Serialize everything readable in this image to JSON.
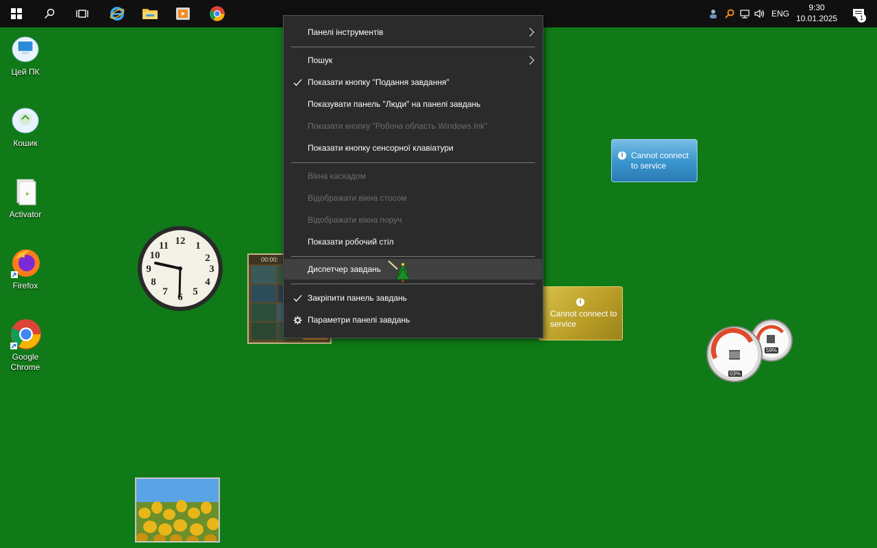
{
  "taskbar": {
    "buttons": [
      "start",
      "search",
      "task-view",
      "internet-explorer",
      "file-explorer",
      "media-player",
      "google-chrome"
    ],
    "lang": "ENG",
    "time": "9:30",
    "date": "10.01.2025",
    "notifications": "1"
  },
  "desktop": {
    "icons": [
      {
        "label": "Цей ПК"
      },
      {
        "label": "Кошик"
      },
      {
        "label": "Activator"
      },
      {
        "label": "Firefox"
      },
      {
        "label": "Google Chrome"
      }
    ]
  },
  "menu": {
    "items": [
      {
        "label": "Панелі інструментів",
        "submenu": true
      },
      {
        "label": "Пошук",
        "submenu": true
      },
      {
        "label": "Показати кнопку \"Подання завдання\"",
        "checked": true
      },
      {
        "label": "Показувати панель \"Люди\" на панелі завдань"
      },
      {
        "label": "Показати кнопку \"Робоча область Windows Ink\"",
        "disabled": true
      },
      {
        "label": "Показати кнопку сенсорної клавіатури"
      },
      {
        "label": "Вікна каскадом",
        "disabled": true
      },
      {
        "label": "Відображати вікна стосом",
        "disabled": true
      },
      {
        "label": "Відображати вікна поруч",
        "disabled": true
      },
      {
        "label": "Показати робочий стіл"
      },
      {
        "label": "Диспетчер завдань",
        "hovered": true
      },
      {
        "label": "Закріпити панель завдань",
        "checked": true
      },
      {
        "label": "Параметри панелі завдань",
        "icon": "gear-icon"
      }
    ]
  },
  "gadgets": {
    "weather_message": "Cannot connect to service",
    "currency_message": "Cannot connect to service",
    "cpu_percent": "03%",
    "memory_percent": "59%",
    "puzzle_timer": "00:00:"
  },
  "colors": {
    "desktop": "#0f7a17",
    "taskbar": "#101010",
    "menu": "#2b2b2b",
    "menu_hover": "#414141"
  }
}
